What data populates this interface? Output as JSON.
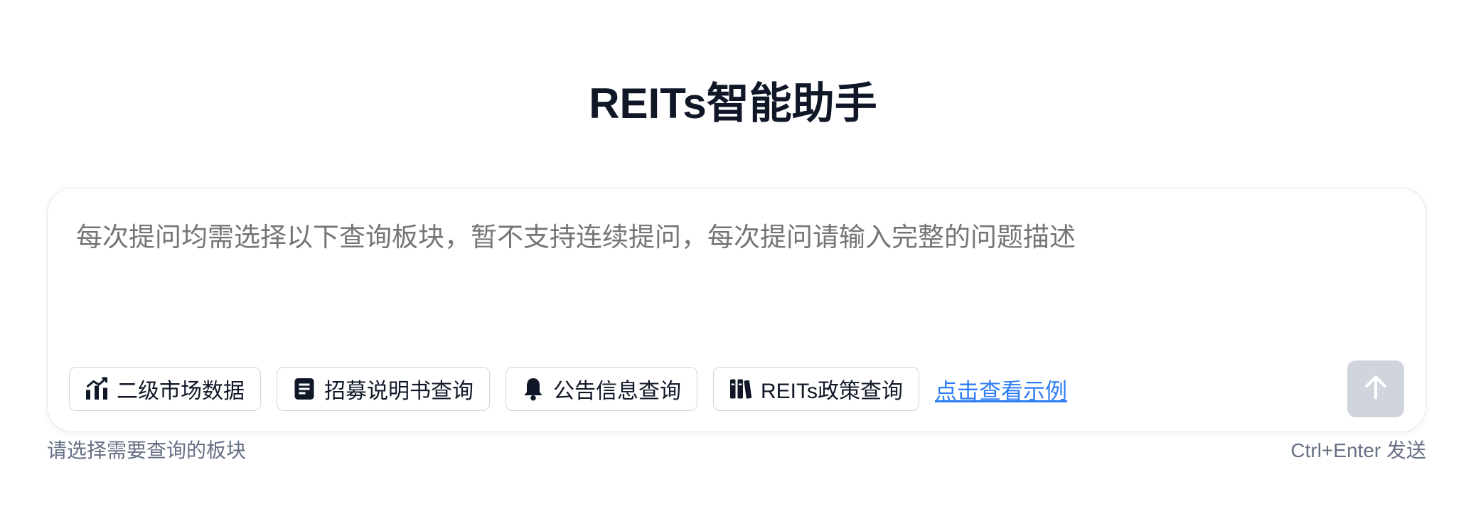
{
  "header": {
    "title": "REITs智能助手"
  },
  "query": {
    "placeholder": "每次提问均需选择以下查询板块，暂不支持连续提问，每次提问请输入完整的问题描述",
    "value": ""
  },
  "sections": [
    {
      "label": "二级市场数据",
      "icon": "bar-chart-trend-icon"
    },
    {
      "label": "招募说明书查询",
      "icon": "document-icon"
    },
    {
      "label": "公告信息查询",
      "icon": "bell-icon"
    },
    {
      "label": "REITs政策查询",
      "icon": "books-icon"
    }
  ],
  "example_link": "点击查看示例",
  "send_icon": "arrow-up-icon",
  "footer": {
    "hint_left": "请选择需要查询的板块",
    "hint_right": "Ctrl+Enter 发送"
  },
  "colors": {
    "title": "#101828",
    "placeholder": "#98a2b3",
    "link": "#2e7cf6",
    "send_button_disabled": "#d0d5dd",
    "hint": "#667085"
  }
}
